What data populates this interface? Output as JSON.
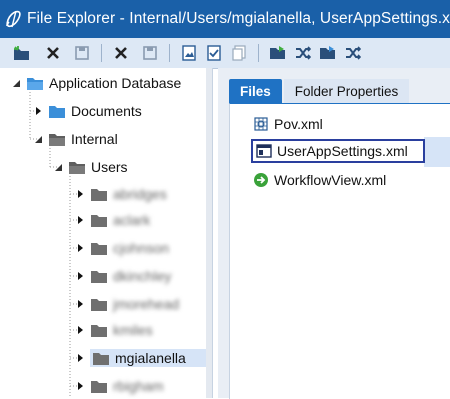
{
  "window": {
    "title": "File Explorer - Internal/Users/mgialanella, UserAppSettings.x"
  },
  "toolbar": {
    "buttons": [
      {
        "icon": "new-folder-icon"
      },
      {
        "icon": "delete-x-icon"
      },
      {
        "icon": "save-disk-icon"
      },
      {
        "icon": "delete-x-icon"
      },
      {
        "icon": "save-disk-icon"
      },
      {
        "icon": "image-file-icon"
      },
      {
        "icon": "checked-file-icon"
      },
      {
        "icon": "copy-file-icon"
      },
      {
        "icon": "open-folder-icon"
      },
      {
        "icon": "shuffle-icon"
      },
      {
        "icon": "open-folder-icon"
      },
      {
        "icon": "shuffle-icon"
      }
    ]
  },
  "tree": {
    "root": "Application Database",
    "documents": "Documents",
    "internal": "Internal",
    "users": "Users",
    "user_items": [
      "abridges",
      "aclark",
      "cjohnson",
      "dkinchley",
      "jmorehead",
      "kmiles"
    ],
    "selected_user": "mgialanella",
    "after_selected": "rbigham"
  },
  "tabs": {
    "files": "Files",
    "folder_properties": "Folder Properties"
  },
  "files": [
    {
      "name": "Pov.xml",
      "icon": "pov-grid-icon"
    },
    {
      "name": "UserAppSettings.xml",
      "icon": "window-settings-icon"
    },
    {
      "name": "WorkflowView.xml",
      "icon": "green-arrow-icon"
    }
  ],
  "colors": {
    "titlebar": "#1a60a8",
    "toolbar": "#dde8f5",
    "selection": "#d6e4f7",
    "active_tab": "#1f72c4",
    "folder_blue": "#3b8fd9",
    "folder_gray": "#6f6f6f"
  }
}
